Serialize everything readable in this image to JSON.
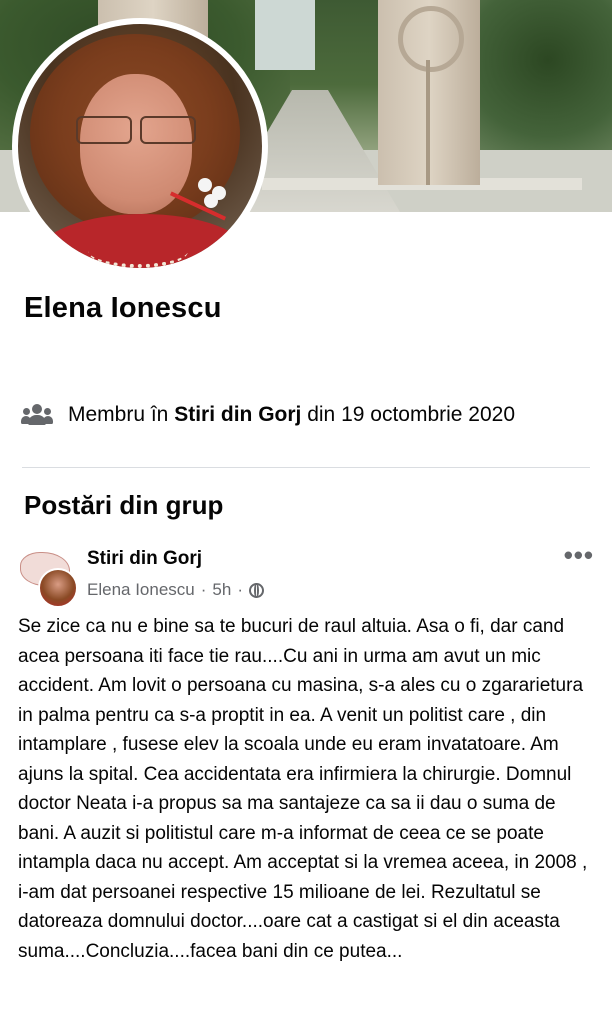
{
  "profile": {
    "name": "Elena Ionescu"
  },
  "membership": {
    "prefix": "Membru în ",
    "group": "Stiri din Gorj",
    "suffix": " din 19 octombrie 2020",
    "icon": "group-icon"
  },
  "section": {
    "title": "Postări din grup"
  },
  "post": {
    "group_name": "Stiri din Gorj",
    "author": "Elena Ionescu",
    "separator": "·",
    "time": "5h",
    "visibility_icon": "globe-icon",
    "more_label": "•••",
    "body": "Se zice ca nu e bine sa te bucuri de raul altuia. Asa o fi, dar cand acea persoana iti face tie rau....Cu ani in urma am avut un mic accident. Am lovit o persoana cu masina, s-a ales cu o zgararietura in palma pentru ca s-a proptit in ea. A venit un politist care , din intamplare , fusese elev la scoala unde eu eram invatatoare. Am ajuns la spital.  Cea accidentata era infirmiera la chirurgie. Domnul doctor Neata i-a propus sa ma santajeze ca sa ii dau o suma de bani. A auzit si politistul care m-a informat de  ceea ce se poate intampla daca nu accept. Am acceptat si la vremea aceea, in 2008 , i-am dat persoanei respective 15 milioane de lei. Rezultatul se datoreaza domnului doctor....oare cat a castigat si el din aceasta suma....Concluzia....facea bani din ce putea..."
  },
  "colors": {
    "text": "#050505",
    "secondary": "#65676b",
    "divider": "#dadde1"
  }
}
